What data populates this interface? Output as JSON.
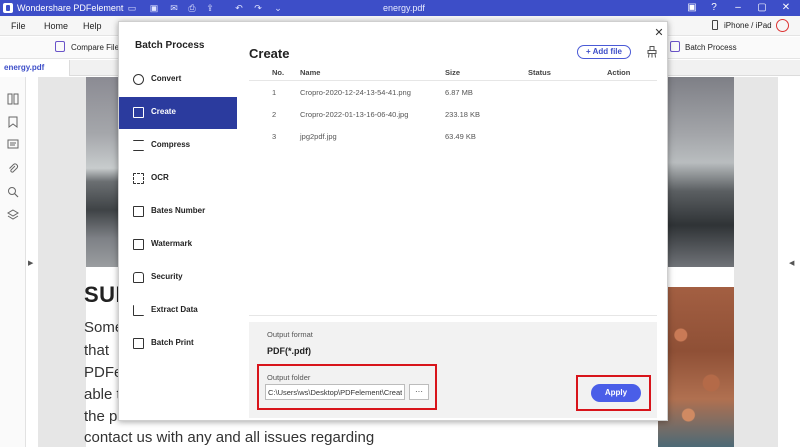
{
  "titlebar": {
    "app_name": "Wondershare PDFelement",
    "document_title": "energy.pdf"
  },
  "menubar": {
    "items": [
      "File",
      "Home",
      "Help"
    ],
    "device_label": "iPhone / iPad"
  },
  "toolbar": {
    "compare_files": "Compare Files",
    "batch_process": "Batch Process"
  },
  "tabs": {
    "document_tab": "energy.pdf"
  },
  "document": {
    "heading": "SUP",
    "lines": [
      "Some",
      "that",
      "PDFel",
      "able t",
      "the pr",
      "contact us with any and all issues regarding"
    ]
  },
  "dialog": {
    "sidebar_title": "Batch Process",
    "nav_items": [
      {
        "label": "Convert",
        "icon": "convert-icon",
        "active": false
      },
      {
        "label": "Create",
        "icon": "create-icon",
        "active": true
      },
      {
        "label": "Compress",
        "icon": "compress-icon",
        "active": false
      },
      {
        "label": "OCR",
        "icon": "ocr-icon",
        "active": false
      },
      {
        "label": "Bates Number",
        "icon": "bates-number-icon",
        "active": false
      },
      {
        "label": "Watermark",
        "icon": "watermark-icon",
        "active": false
      },
      {
        "label": "Security",
        "icon": "security-icon",
        "active": false
      },
      {
        "label": "Extract Data",
        "icon": "extract-data-icon",
        "active": false
      },
      {
        "label": "Batch Print",
        "icon": "batch-print-icon",
        "active": false
      }
    ],
    "content_title": "Create",
    "add_file_label": "+ Add file",
    "table": {
      "headers": {
        "no": "No.",
        "name": "Name",
        "size": "Size",
        "status": "Status",
        "action": "Action"
      },
      "rows": [
        {
          "no": "1",
          "name": "Cropro-2020-12-24-13-54-41.png",
          "size": "6.87 MB",
          "status": "",
          "action": ""
        },
        {
          "no": "2",
          "name": "Cropro-2022-01-13-16-06-40.jpg",
          "size": "233.18 KB",
          "status": "",
          "action": ""
        },
        {
          "no": "3",
          "name": "jpg2pdf.jpg",
          "size": "63.49 KB",
          "status": "",
          "action": ""
        }
      ]
    },
    "output_format_label": "Output format",
    "output_format_value": "PDF(*.pdf)",
    "output_folder_label": "Output folder",
    "output_folder_value": "C:\\Users\\ws\\Desktop\\PDFelement\\Create",
    "browse_label": "···",
    "apply_label": "Apply"
  },
  "colors": {
    "titlebar": "#3d4ec8",
    "sidebar_active": "#2b3b9e",
    "apply_button": "#4a5ee8",
    "highlight": "#d8141b"
  }
}
